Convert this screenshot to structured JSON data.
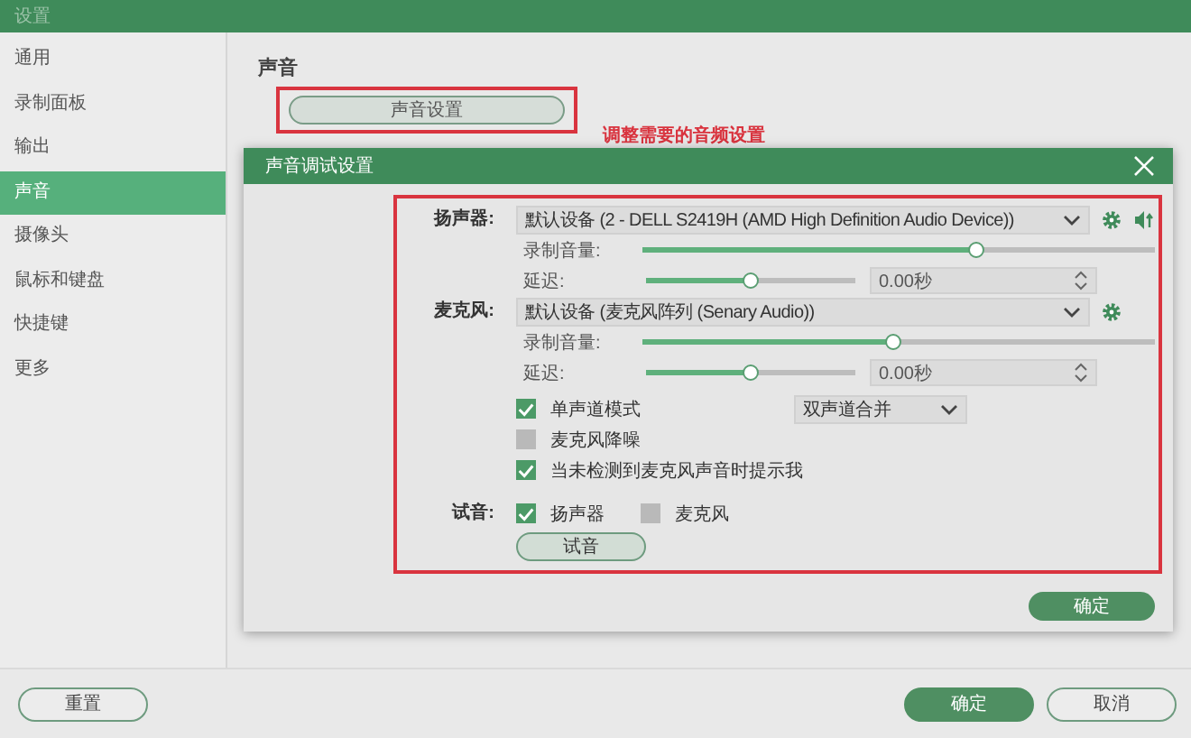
{
  "window": {
    "title": "设置"
  },
  "sidebar": {
    "items": [
      {
        "label": "通用",
        "selected": false
      },
      {
        "label": "录制面板",
        "selected": false
      },
      {
        "label": "输出",
        "selected": false
      },
      {
        "label": "声音",
        "selected": true
      },
      {
        "label": "摄像头",
        "selected": false
      },
      {
        "label": "鼠标和键盘",
        "selected": false
      },
      {
        "label": "快捷键",
        "selected": false
      },
      {
        "label": "更多",
        "selected": false
      }
    ]
  },
  "section": {
    "title": "声音",
    "button": "声音设置",
    "annotation": "调整需要的音频设置"
  },
  "dialog": {
    "title": "声音调试设置",
    "devices": [
      {
        "label": "扬声器:",
        "device": "默认设备 (2 - DELL S2419H (AMD High Definition Audio Device))",
        "volume_label": "录制音量:",
        "volume": {
          "level": 0.65
        },
        "delay_label": "延迟:",
        "delay": {
          "level": 0.5
        },
        "delay_value": "0.00秒",
        "speaker_icon": true
      },
      {
        "label": "麦克风:",
        "device": "默认设备 (麦克风阵列 (Senary Audio))",
        "volume_label": "录制音量:",
        "volume": {
          "level": 0.49
        },
        "delay_label": "延迟:",
        "delay": {
          "level": 0.5
        },
        "delay_value": "0.00秒",
        "speaker_icon": false
      }
    ],
    "options": [
      {
        "label": "单声道模式",
        "checked": true,
        "select": "双声道合并"
      },
      {
        "label": "麦克风降噪",
        "checked": false
      },
      {
        "label": "当未检测到麦克风声音时提示我",
        "checked": true
      }
    ],
    "test": {
      "label": "试音:",
      "options": [
        {
          "label": "扬声器",
          "checked": true
        },
        {
          "label": "麦克风",
          "checked": false
        }
      ],
      "button": "试音"
    },
    "ok_button": "确定"
  },
  "footer": {
    "reset": "重置",
    "ok": "确定",
    "cancel": "取消"
  }
}
